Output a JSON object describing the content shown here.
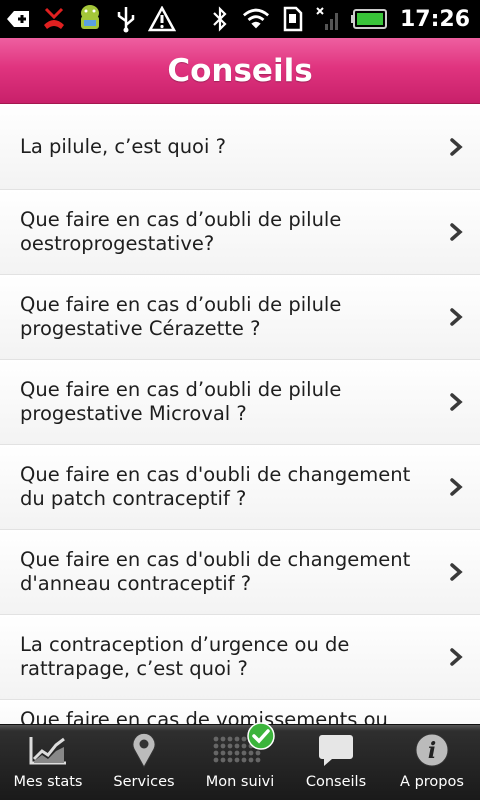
{
  "status_bar": {
    "time": "17:26",
    "icons": [
      "notification-plus-icon",
      "missed-call-icon",
      "android-icon",
      "usb-icon",
      "warning-icon",
      "bluetooth-icon",
      "wifi-icon",
      "sd-card-icon",
      "signal-icon",
      "battery-icon"
    ]
  },
  "header": {
    "title": "Conseils"
  },
  "list": {
    "items": [
      {
        "label": "La pilule, c’est quoi ?"
      },
      {
        "label": "Que faire en cas d’oubli de pilule oestroprogestative?"
      },
      {
        "label": "Que faire en cas d’oubli de pilule progestative Cérazette ?"
      },
      {
        "label": "Que faire en cas d’oubli de pilule progestative Microval ?"
      },
      {
        "label": "Que faire en cas d'oubli de changement du patch contraceptif ?"
      },
      {
        "label": "Que faire en cas d'oubli de changement d'anneau contraceptif ?"
      },
      {
        "label": "La contraception d’urgence ou de rattrapage, c’est quoi ?"
      },
      {
        "label": "Que faire en cas de vomissements ou"
      }
    ]
  },
  "tabs": [
    {
      "label": "Mes stats",
      "icon": "chart-icon"
    },
    {
      "label": "Services",
      "icon": "map-pin-icon"
    },
    {
      "label": "Mon suivi",
      "icon": "pill-grid-icon"
    },
    {
      "label": "Conseils",
      "icon": "speech-bubble-icon"
    },
    {
      "label": "A propos",
      "icon": "info-icon"
    }
  ],
  "colors": {
    "header_pink": "#e0347f",
    "check_green": "#3cb43c"
  }
}
